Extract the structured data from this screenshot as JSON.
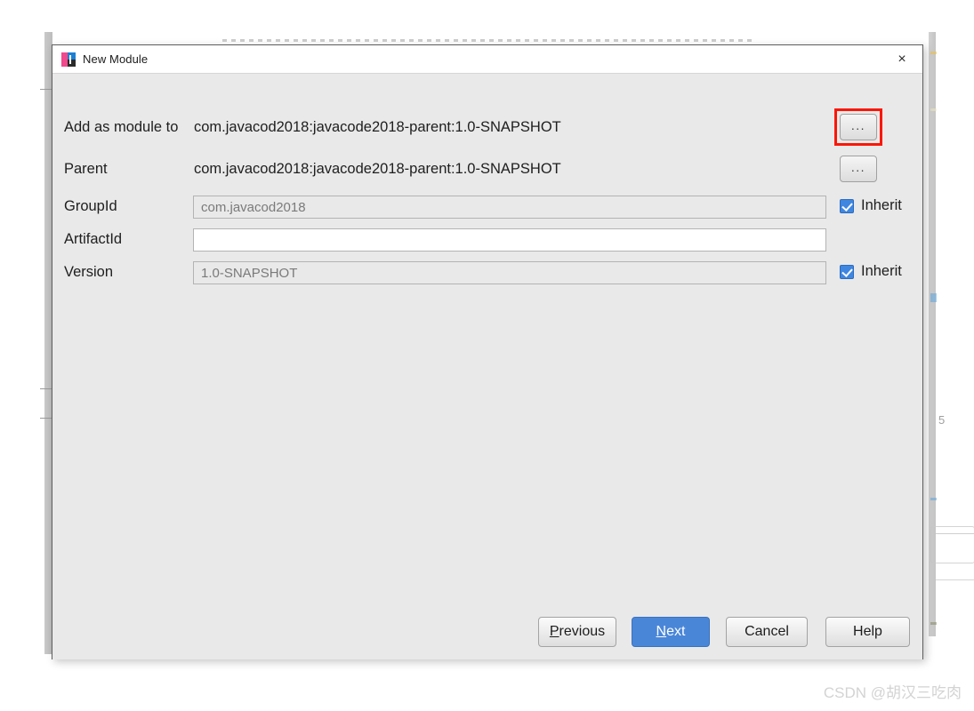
{
  "window": {
    "title": "New Module",
    "icon": "intellij-idea-icon",
    "close_label": "×"
  },
  "form": {
    "rows": [
      {
        "label": "Add as module to",
        "value": "com.javacod2018:javacode2018-parent:1.0-SNAPSHOT",
        "kind": "text",
        "browse_label": "...",
        "highlighted": true
      },
      {
        "label": "Parent",
        "value": "com.javacod2018:javacode2018-parent:1.0-SNAPSHOT",
        "kind": "text",
        "browse_label": "...",
        "highlighted": false
      },
      {
        "label": "GroupId",
        "value": "com.javacod2018",
        "kind": "input-disabled",
        "inherit_label": "Inherit",
        "inherit_checked": true
      },
      {
        "label": "ArtifactId",
        "value": "",
        "kind": "input",
        "placeholder": ""
      },
      {
        "label": "Version",
        "value": "1.0-SNAPSHOT",
        "kind": "input-disabled",
        "inherit_label": "Inherit",
        "inherit_checked": true
      }
    ]
  },
  "footer": {
    "previous": {
      "prefix": "P",
      "rest": "revious"
    },
    "next": {
      "prefix": "N",
      "rest": "ext"
    },
    "cancel": "Cancel",
    "help": "Help"
  },
  "watermark": "CSDN @胡汉三吃肉",
  "colors": {
    "dialog_bg": "#e9e9e9",
    "titlebar_bg": "#ffffff",
    "accent_blue": "#4a86d8",
    "checkbox_blue": "#3f86e0",
    "highlight_red": "#fb1606",
    "disabled_text": "#7a7a7a"
  }
}
